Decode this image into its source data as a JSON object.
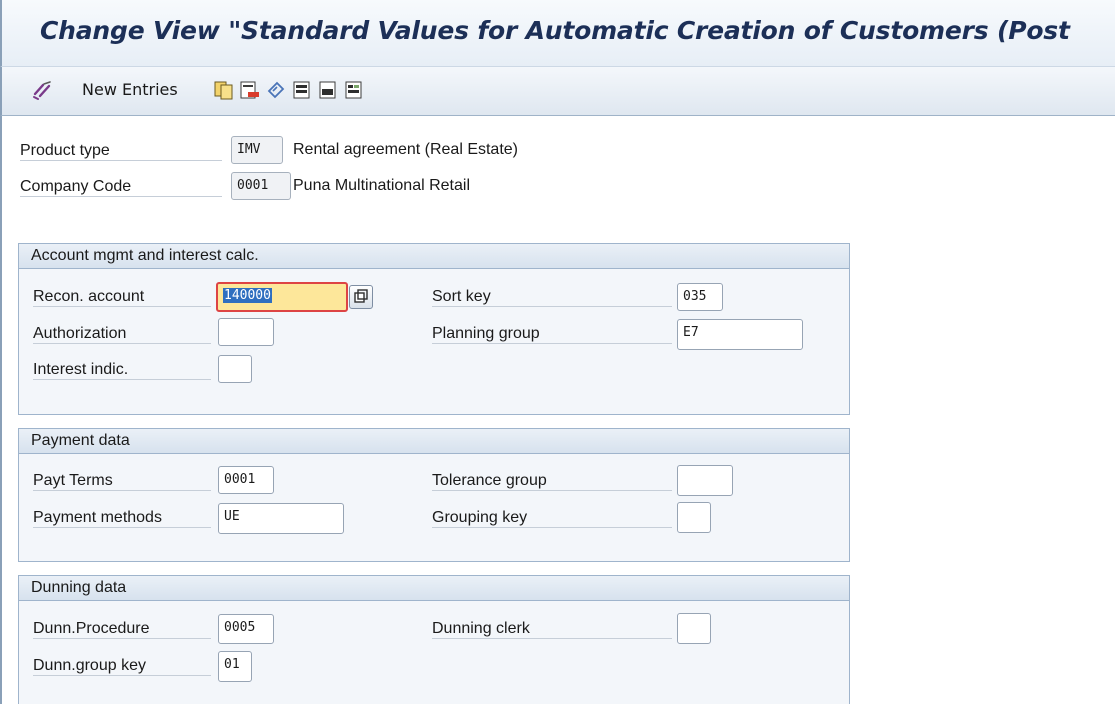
{
  "title": "Change View \"Standard Values for Automatic Creation of Customers (Post",
  "toolbar": {
    "new_entries_label": "New Entries",
    "icons": [
      "edit-glasses-icon",
      "copy-icon",
      "delete-icon",
      "undo-icon",
      "select-all-icon",
      "select-block-icon",
      "deselect-all-icon"
    ]
  },
  "header": {
    "product_type": {
      "label": "Product type",
      "value": "IMV",
      "description": "Rental agreement (Real Estate)"
    },
    "company_code": {
      "label": "Company Code",
      "value": "0001",
      "description": "Puna Multinational Retail"
    }
  },
  "account_group": {
    "title": "Account mgmt and interest calc.",
    "recon_account": {
      "label": "Recon. account",
      "value": "140000"
    },
    "authorization": {
      "label": "Authorization",
      "value": ""
    },
    "interest_indic": {
      "label": "Interest indic.",
      "value": ""
    },
    "sort_key": {
      "label": "Sort key",
      "value": "035"
    },
    "planning_group": {
      "label": "Planning group",
      "value": "E7"
    }
  },
  "payment_group": {
    "title": "Payment data",
    "payt_terms": {
      "label": "Payt Terms",
      "value": "0001"
    },
    "payment_methods": {
      "label": "Payment methods",
      "value": "UE"
    },
    "tolerance_group": {
      "label": "Tolerance group",
      "value": ""
    },
    "grouping_key": {
      "label": "Grouping key",
      "value": ""
    }
  },
  "dunning_group": {
    "title": "Dunning data",
    "dunn_procedure": {
      "label": "Dunn.Procedure",
      "value": "0005"
    },
    "dunn_group_key": {
      "label": "Dunn.group key",
      "value": "01"
    },
    "dunning_clerk": {
      "label": "Dunning clerk",
      "value": ""
    }
  },
  "colors": {
    "title_text": "#1c2f57",
    "focus_field": "#fde79a",
    "selection": "#2f6fc0",
    "group_border": "#9fb4cc"
  }
}
